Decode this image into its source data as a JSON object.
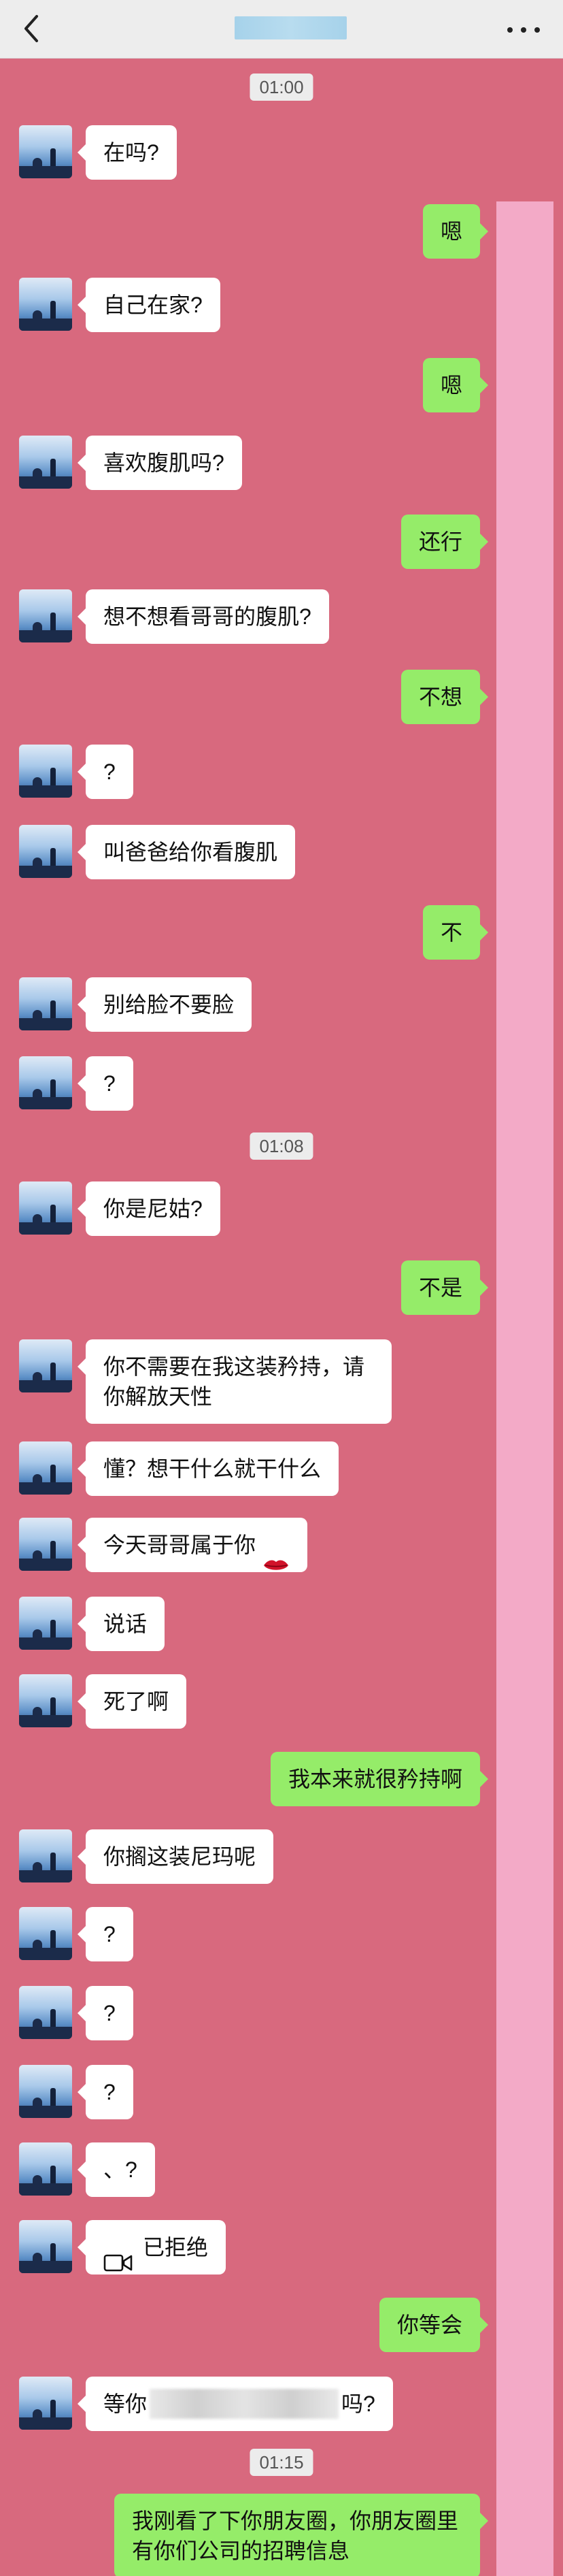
{
  "header": {
    "back_icon": "chevron-left-icon",
    "more_icon": "more-dots-icon"
  },
  "messages": [
    {
      "side": "ts",
      "text": "01:00"
    },
    {
      "side": "in",
      "text": "在吗?"
    },
    {
      "side": "out",
      "text": "嗯"
    },
    {
      "side": "in",
      "text": "自己在家?"
    },
    {
      "side": "out",
      "text": "嗯"
    },
    {
      "side": "in",
      "text": "喜欢腹肌吗?"
    },
    {
      "side": "out",
      "text": "还行"
    },
    {
      "side": "in",
      "text": "想不想看哥哥的腹肌?"
    },
    {
      "side": "out",
      "text": "不想"
    },
    {
      "side": "in",
      "text": "?"
    },
    {
      "side": "in",
      "text": "叫爸爸给你看腹肌"
    },
    {
      "side": "out",
      "text": "不"
    },
    {
      "side": "in",
      "text": "别给脸不要脸"
    },
    {
      "side": "in",
      "text": "?"
    },
    {
      "side": "ts",
      "text": "01:08"
    },
    {
      "side": "in",
      "text": "你是尼姑?"
    },
    {
      "side": "out",
      "text": "不是"
    },
    {
      "side": "in",
      "text": "你不需要在我这装矜持，请你解放天性"
    },
    {
      "side": "in",
      "text": "懂？想干什么就干什么"
    },
    {
      "side": "in",
      "text": "今天哥哥属于你"
    },
    {
      "side": "in",
      "text": "说话"
    },
    {
      "side": "in",
      "text": "死了啊"
    },
    {
      "side": "out",
      "text": "我本来就很矜持啊"
    },
    {
      "side": "in",
      "text": "你搁这装尼玛呢"
    },
    {
      "side": "in",
      "text": "?"
    },
    {
      "side": "in",
      "text": "?"
    },
    {
      "side": "in",
      "text": "?"
    },
    {
      "side": "in",
      "text": "、?"
    },
    {
      "side": "in",
      "text": "已拒绝"
    },
    {
      "side": "out",
      "text": "你等会"
    },
    {
      "side": "in",
      "text_before": "等你",
      "text_after": "吗?"
    },
    {
      "side": "ts",
      "text": "01:15"
    },
    {
      "side": "out",
      "text": "我刚看了下你朋友圈，你朋友圈里有你们公司的招聘信息"
    }
  ]
}
